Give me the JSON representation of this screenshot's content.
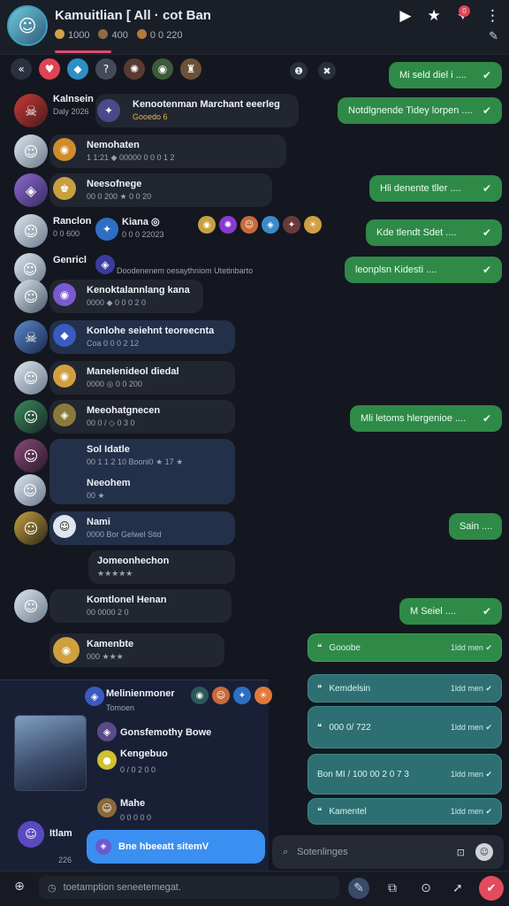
{
  "header": {
    "title": "Kamuitlian [ All · cot Ban",
    "sub": [
      "1000",
      "400",
      "0 0 220"
    ],
    "icons": [
      "play-icon",
      "star-icon",
      "pin-icon",
      "more-icon",
      "edit-icon"
    ],
    "badge": "0"
  },
  "left_messages": [
    {
      "name": "Kalnsein",
      "sub": "Daly 2026",
      "extra": "Kenootenman Marchant eeerleg",
      "extra2": "Gooedo 6"
    },
    {
      "name": "Nemohaten",
      "sub": "1 1:21  ◆ 00000 0 0 0 1 2"
    },
    {
      "name": "Neesofnege",
      "sub": "00 0 200 ★ 0 0 20"
    },
    {
      "name": "Ranclon",
      "sub": "0 0 600",
      "extra": "Kiana ◎",
      "extra2": "0 0 0 22023"
    },
    {
      "name": "Genricl",
      "sub": "Doodenenem oesaythniom Utetinbarto"
    },
    {
      "name": "Kenoktalannlang kana",
      "sub": "0000 ◆ 0 0 0 2 0"
    },
    {
      "name": "Konlohe seiehnt teoreecnta",
      "sub": "Coa 0 0 0 2 12"
    },
    {
      "name": "Manelenideol diedal",
      "sub": "0000 ◎ 0 0 200"
    },
    {
      "name": "Meeohatgnecen",
      "sub": "00 0 / ◇ 0 3 0"
    },
    {
      "name": "Sol Idatle",
      "sub": "00 1 1 2 10 Booni0 ★ 17 ★"
    },
    {
      "name": "Neeohem",
      "sub": "00 ★"
    },
    {
      "name": "Nami",
      "sub": "0000 Bor Gelwel Stid"
    },
    {
      "name": "Jomeonhechon",
      "sub": "★★★★★"
    },
    {
      "name": "Komtlonel Henan",
      "sub": "00 0000 2 0"
    },
    {
      "name": "Kamenbte",
      "sub": "000 ★★★"
    }
  ],
  "right_messages": [
    {
      "text": "Mi seld diel i ...."
    },
    {
      "text": "Notdlgnende Tidey lorpen ...."
    },
    {
      "text": "Hli denente tller ...."
    },
    {
      "text": "Kde tlendt Sdet ...."
    },
    {
      "text": "leonplsn Kidesti ...."
    },
    {
      "text": "Mli letoms hlergenioe ...."
    },
    {
      "text": "Sain ...."
    },
    {
      "text": "M Seiel ...."
    }
  ],
  "teal_messages": [
    {
      "label": "Gooobe",
      "meta": "1ldd men"
    },
    {
      "label": "Kemdelsin",
      "meta": "1ldd men"
    },
    {
      "label": "000 0/ 722",
      "meta": "1ldd men"
    },
    {
      "label": "Bon MI / 100 00 2 0 7 3",
      "meta": "1ldd men"
    },
    {
      "label": "Kamentel",
      "meta": "1ldd men"
    }
  ],
  "panel": {
    "title": "Melinienmoner",
    "sub": "Tomoen",
    "row1": "Gonsfemothy Bowe",
    "row2": "Kengebuo",
    "row2sub": "0 / 0 2 0 0",
    "row3": "Mahe",
    "row3sub": "0 0 0 0 0",
    "row4": "Itlam",
    "row4sub": "226",
    "blue": "Bne hbeeatt sitemV"
  },
  "search": {
    "placeholder": "Sotenlinges"
  },
  "input": {
    "placeholder": "toetamption seneetemegat."
  },
  "colors": {
    "accent": "#e44a5e",
    "green": "#2f8a48",
    "teal": "#2e6f73",
    "blue": "#3a8ff0"
  }
}
